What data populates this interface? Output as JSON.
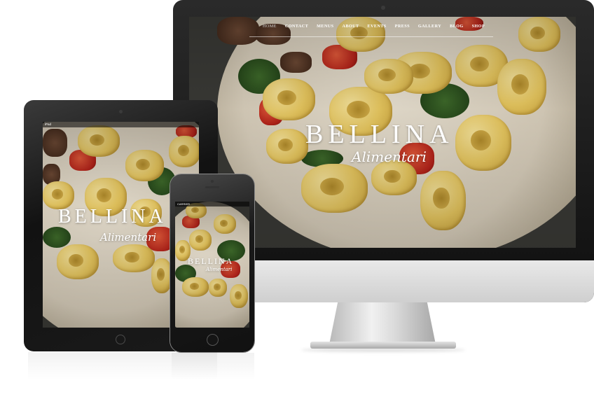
{
  "site": {
    "brand": "BELLINA",
    "tagline": "Alimentari"
  },
  "nav": {
    "items": [
      "HOME",
      "CONTACT",
      "MENUS",
      "ABOUT",
      "EVENTS",
      "PRESS",
      "GALLERY",
      "BLOG",
      "SHOP"
    ],
    "active": "HOME"
  },
  "tablet_status": {
    "carrier": "iPad"
  },
  "phone_status": {
    "carrier": "CARRIER"
  },
  "colors": {
    "device_frame": "#111111",
    "monitor_chin": "#dcdcdc",
    "brand_text": "#ffffff",
    "plate": "#e3dac8",
    "pasta": "#e8c860",
    "tomato": "#c0301f"
  }
}
